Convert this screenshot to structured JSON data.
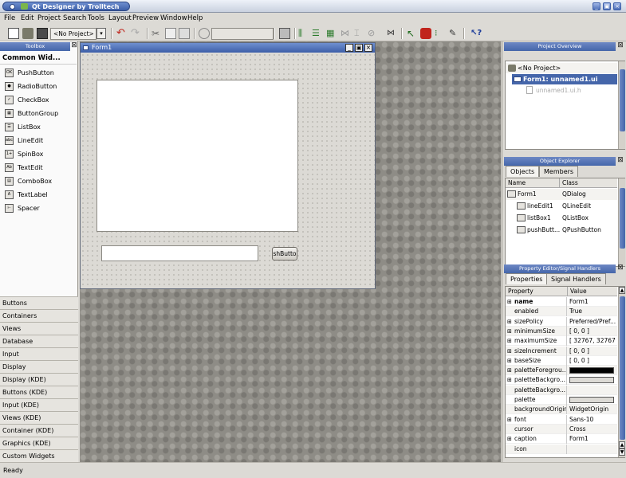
{
  "app": {
    "title": "Qt Designer by Trolltech"
  },
  "menu": [
    "File",
    "Edit",
    "Project",
    "Search",
    "Tools",
    "Layout",
    "Preview",
    "Window",
    "Help"
  ],
  "toolbar": {
    "project_combo": "<No Project>"
  },
  "toolbox": {
    "header": "Toolbox",
    "section": "Common Wid...",
    "items": [
      "PushButton",
      "RadioButton",
      "CheckBox",
      "ButtonGroup",
      "ListBox",
      "LineEdit",
      "SpinBox",
      "TextEdit",
      "ComboBox",
      "TextLabel",
      "Spacer"
    ],
    "icons": [
      "OK",
      "●",
      "✓",
      "▦",
      "☰",
      "abc",
      "1+",
      "Ab",
      "▤",
      "A",
      "⊢"
    ],
    "categories": [
      "Buttons",
      "Containers",
      "Views",
      "Database",
      "Input",
      "Display",
      "Display (KDE)",
      "Buttons (KDE)",
      "Input (KDE)",
      "Views (KDE)",
      "Container (KDE)",
      "Graphics (KDE)",
      "Custom Widgets"
    ]
  },
  "form": {
    "title": "Form1",
    "push_button": "shButto"
  },
  "project_overview": {
    "header": "Project Overview",
    "items": [
      "<No Project>",
      "Form1: unnamed1.ui",
      "unnamed1.ui.h"
    ]
  },
  "object_explorer": {
    "header": "Object Explorer",
    "tabs": [
      "Objects",
      "Members"
    ],
    "columns": [
      "Name",
      "Class"
    ],
    "rows": [
      {
        "name": "Form1",
        "class": "QDialog"
      },
      {
        "name": "lineEdit1",
        "class": "QLineEdit"
      },
      {
        "name": "listBox1",
        "class": "QListBox"
      },
      {
        "name": "pushButt...",
        "class": "QPushButton"
      }
    ]
  },
  "property_editor": {
    "header": "Property Editor/Signal Handlers",
    "tabs": [
      "Properties",
      "Signal Handlers"
    ],
    "columns": [
      "Property",
      "Value"
    ],
    "rows": [
      {
        "exp": "⊞",
        "name": "name",
        "value": "Form1",
        "bold": true
      },
      {
        "exp": "",
        "name": "enabled",
        "value": "True"
      },
      {
        "exp": "⊞",
        "name": "sizePolicy",
        "value": "Preferred/Pref..."
      },
      {
        "exp": "⊞",
        "name": "minimumSize",
        "value": "[ 0, 0 ]"
      },
      {
        "exp": "⊞",
        "name": "maximumSize",
        "value": "[ 32767, 32767 ]"
      },
      {
        "exp": "⊞",
        "name": "sizeIncrement",
        "value": "[ 0, 0 ]"
      },
      {
        "exp": "⊞",
        "name": "baseSize",
        "value": "[ 0, 0 ]"
      },
      {
        "exp": "⊞",
        "name": "paletteForegrou...",
        "value": "",
        "swatch": "#000000"
      },
      {
        "exp": "⊞",
        "name": "paletteBackgro...",
        "value": "",
        "swatch": "#dcdad5"
      },
      {
        "exp": "",
        "name": "paletteBackgro...",
        "value": ""
      },
      {
        "exp": "",
        "name": "palette",
        "value": "",
        "swatch": "#dcdad5"
      },
      {
        "exp": "",
        "name": "backgroundOrigin",
        "value": "WidgetOrigin"
      },
      {
        "exp": "⊞",
        "name": "font",
        "value": "Sans-10"
      },
      {
        "exp": "",
        "name": "cursor",
        "value": "Cross"
      },
      {
        "exp": "⊞",
        "name": "caption",
        "value": "Form1"
      },
      {
        "exp": "",
        "name": "icon",
        "value": ""
      }
    ]
  },
  "status": "Ready",
  "colors": {
    "accent": "#4566aa",
    "panel": "#dcdad5",
    "workspace": "#8e8c86"
  }
}
